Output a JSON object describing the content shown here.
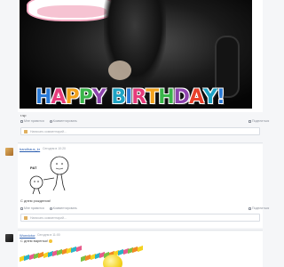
{
  "post1": {
    "banner_text": "HAPPY BIRTHDAY!",
    "caption": "r.sp",
    "actions": {
      "like": "Мне нравится",
      "comment": "Комментировать"
    },
    "share": "Поделиться",
    "comment_placeholder": "Написать комментарий…"
  },
  "post2": {
    "author": "bandhaus_kr",
    "time": "Сегодня в 10:20",
    "drawing_label": "РАТ",
    "caption": "С днем рождения!",
    "actions": {
      "like": "Мне нравится",
      "comment": "Комментировать"
    },
    "share": "Поделиться",
    "comment_placeholder": "Написать комментарий…"
  },
  "post3": {
    "author": "Wonvictor",
    "time": "Сегодня в 11:00",
    "caption": "С днем варенья!"
  },
  "colors": {
    "link": "#2a5db0",
    "accent": "#e0b060",
    "background": "#f5f6f8"
  }
}
